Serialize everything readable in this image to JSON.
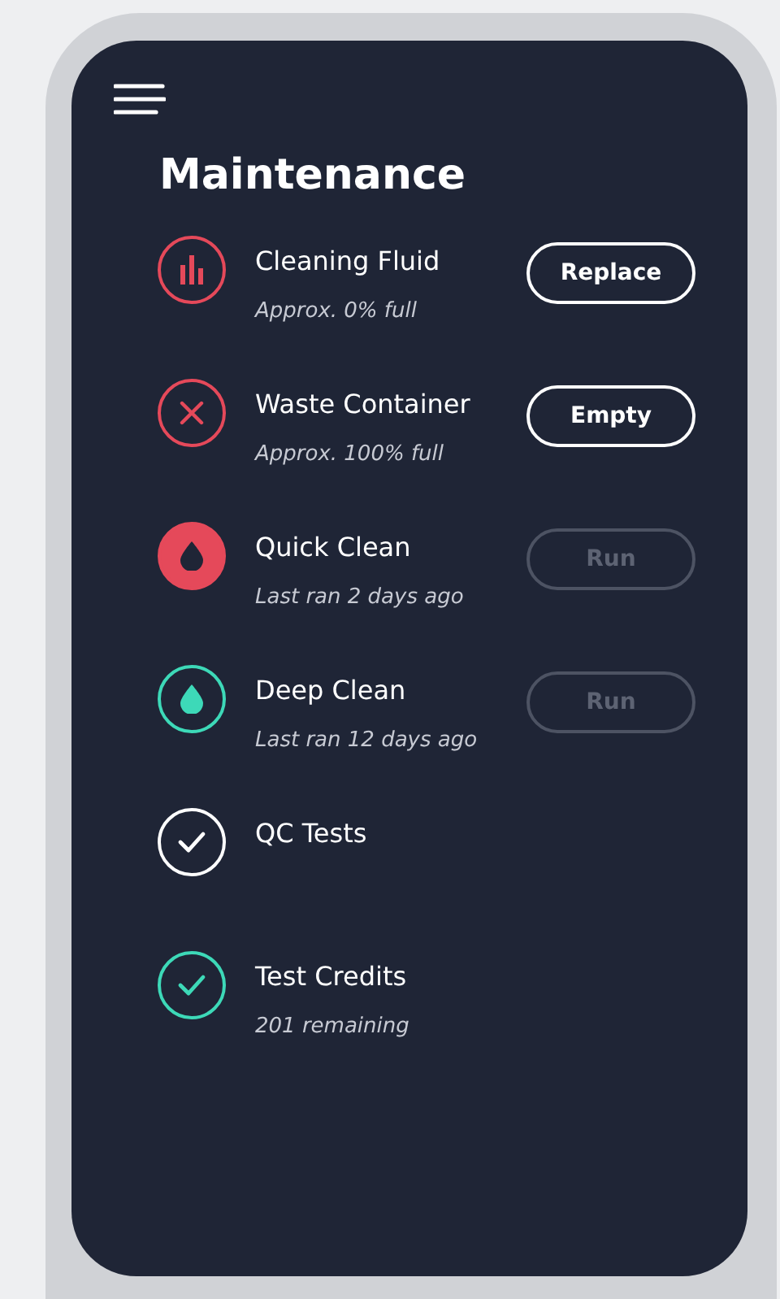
{
  "title": "Maintenance",
  "items": [
    {
      "name": "Cleaning Fluid",
      "detail": "Approx. 0% full",
      "kind": "bars",
      "color": "#e5495a",
      "filled": false,
      "action": {
        "label": "Replace",
        "disabled": false
      }
    },
    {
      "name": "Waste Container",
      "detail": "Approx. 100% full",
      "kind": "cross",
      "color": "#e5495a",
      "filled": false,
      "action": {
        "label": "Empty",
        "disabled": false
      }
    },
    {
      "name": "Quick Clean",
      "detail": "Last ran 2 days ago",
      "kind": "drop",
      "color": "#e5495a",
      "filled": true,
      "action": {
        "label": "Run",
        "disabled": true
      }
    },
    {
      "name": "Deep Clean",
      "detail": "Last ran 12 days ago",
      "kind": "drop",
      "color": "#3dd9b8",
      "filled": false,
      "action": {
        "label": "Run",
        "disabled": true
      }
    },
    {
      "name": "QC Tests",
      "kind": "check",
      "color": "#ffffff",
      "filled": false
    },
    {
      "name": "Test Credits",
      "detail": "201 remaining",
      "kind": "check",
      "color": "#3dd9b8",
      "filled": false
    }
  ]
}
